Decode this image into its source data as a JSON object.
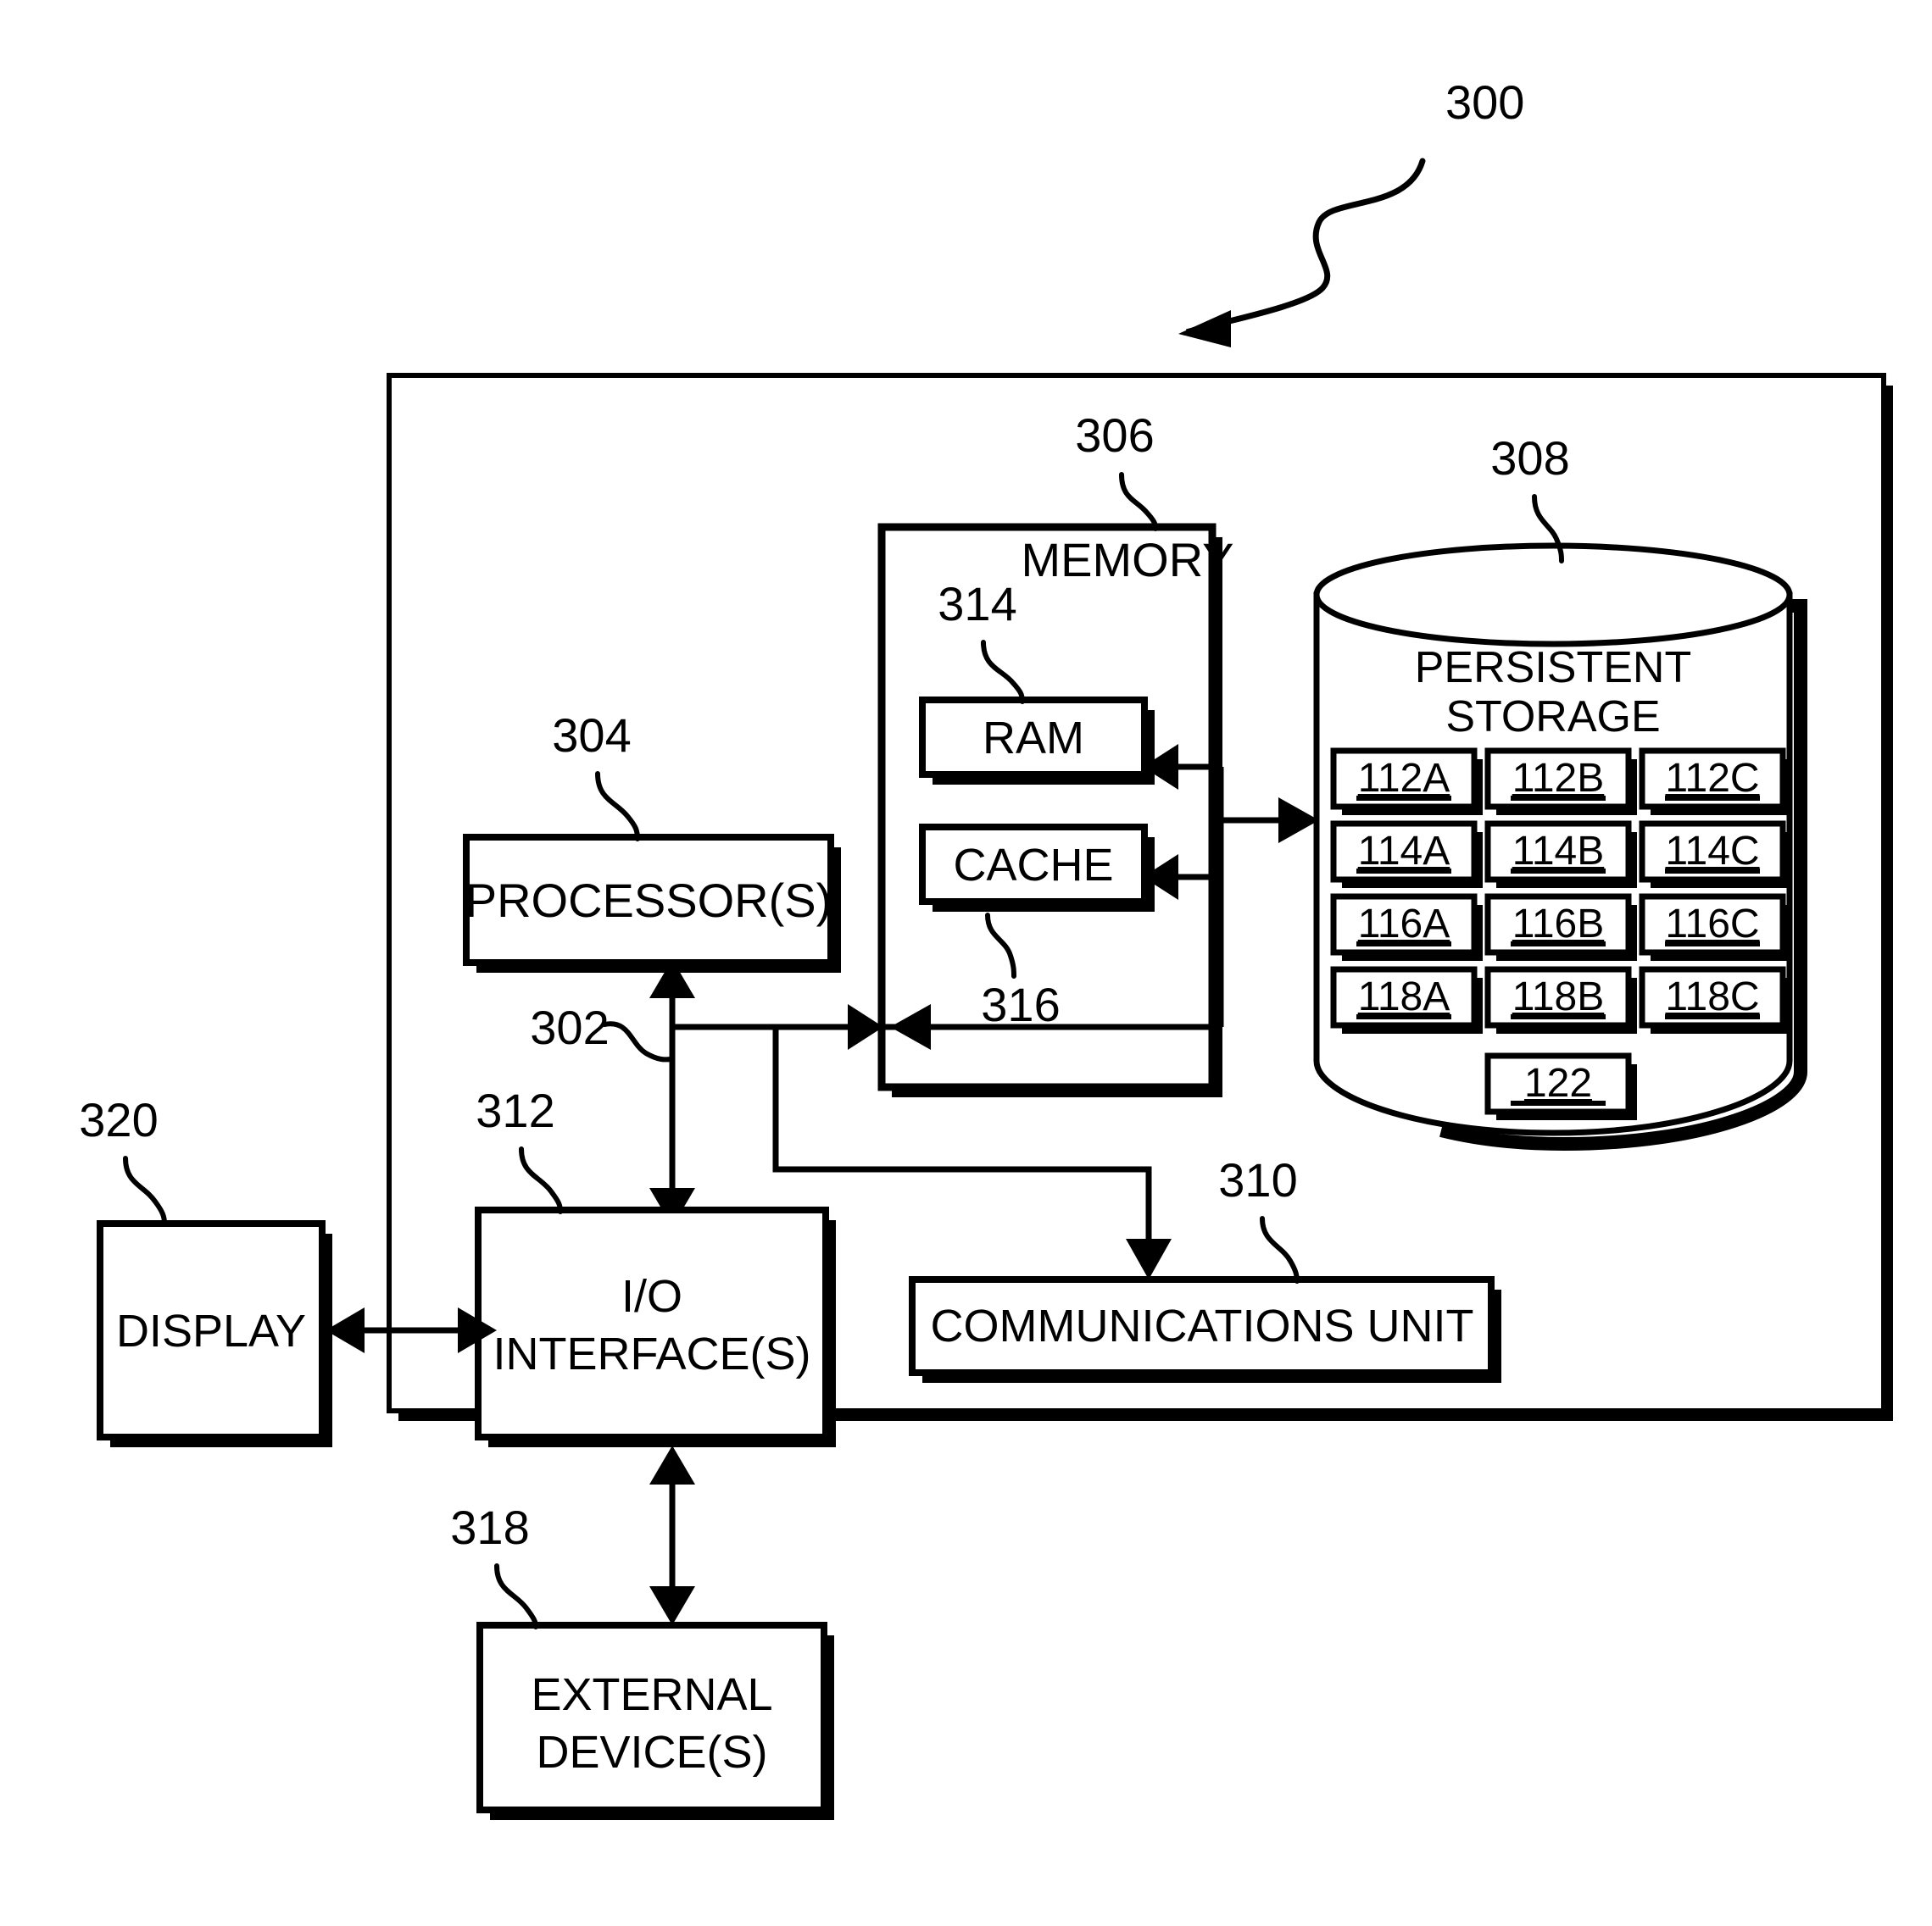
{
  "figure": {
    "number": "300",
    "title_ref": "300"
  },
  "outer_container": {
    "ref": "300",
    "name": "computer-system"
  },
  "blocks": {
    "processor": {
      "label": "PROCESSOR(S)",
      "ref": "304"
    },
    "memory": {
      "label": "MEMORY",
      "ref": "306"
    },
    "ram": {
      "label": "RAM",
      "ref": "314"
    },
    "cache": {
      "label": "CACHE",
      "ref": "316"
    },
    "persistent_storage": {
      "label_line1": "PERSISTENT",
      "label_line2": "STORAGE",
      "ref": "308"
    },
    "communications_unit": {
      "label": "COMMUNICATIONS UNIT",
      "ref": "310"
    },
    "io_interface": {
      "label_line1": "I/O",
      "label_line2": "INTERFACE(S)",
      "ref": "312"
    },
    "display": {
      "label": "DISPLAY",
      "ref": "320"
    },
    "external_device": {
      "label_line1": "EXTERNAL",
      "label_line2": "DEVICE(S)",
      "ref": "318"
    },
    "bus": {
      "ref": "302"
    }
  },
  "storage_items": {
    "rows": [
      [
        "112A",
        "112B",
        "112C"
      ],
      [
        "114A",
        "114B",
        "114C"
      ],
      [
        "116A",
        "116B",
        "116C"
      ],
      [
        "118A",
        "118B",
        "118C"
      ]
    ],
    "extra": "122"
  },
  "reference_numerals": [
    "300",
    "302",
    "304",
    "306",
    "308",
    "310",
    "312",
    "314",
    "316",
    "318",
    "320"
  ],
  "colors": {
    "stroke": "#000000",
    "fill": "#ffffff",
    "shadow": "#000000",
    "background": "#ffffff"
  }
}
